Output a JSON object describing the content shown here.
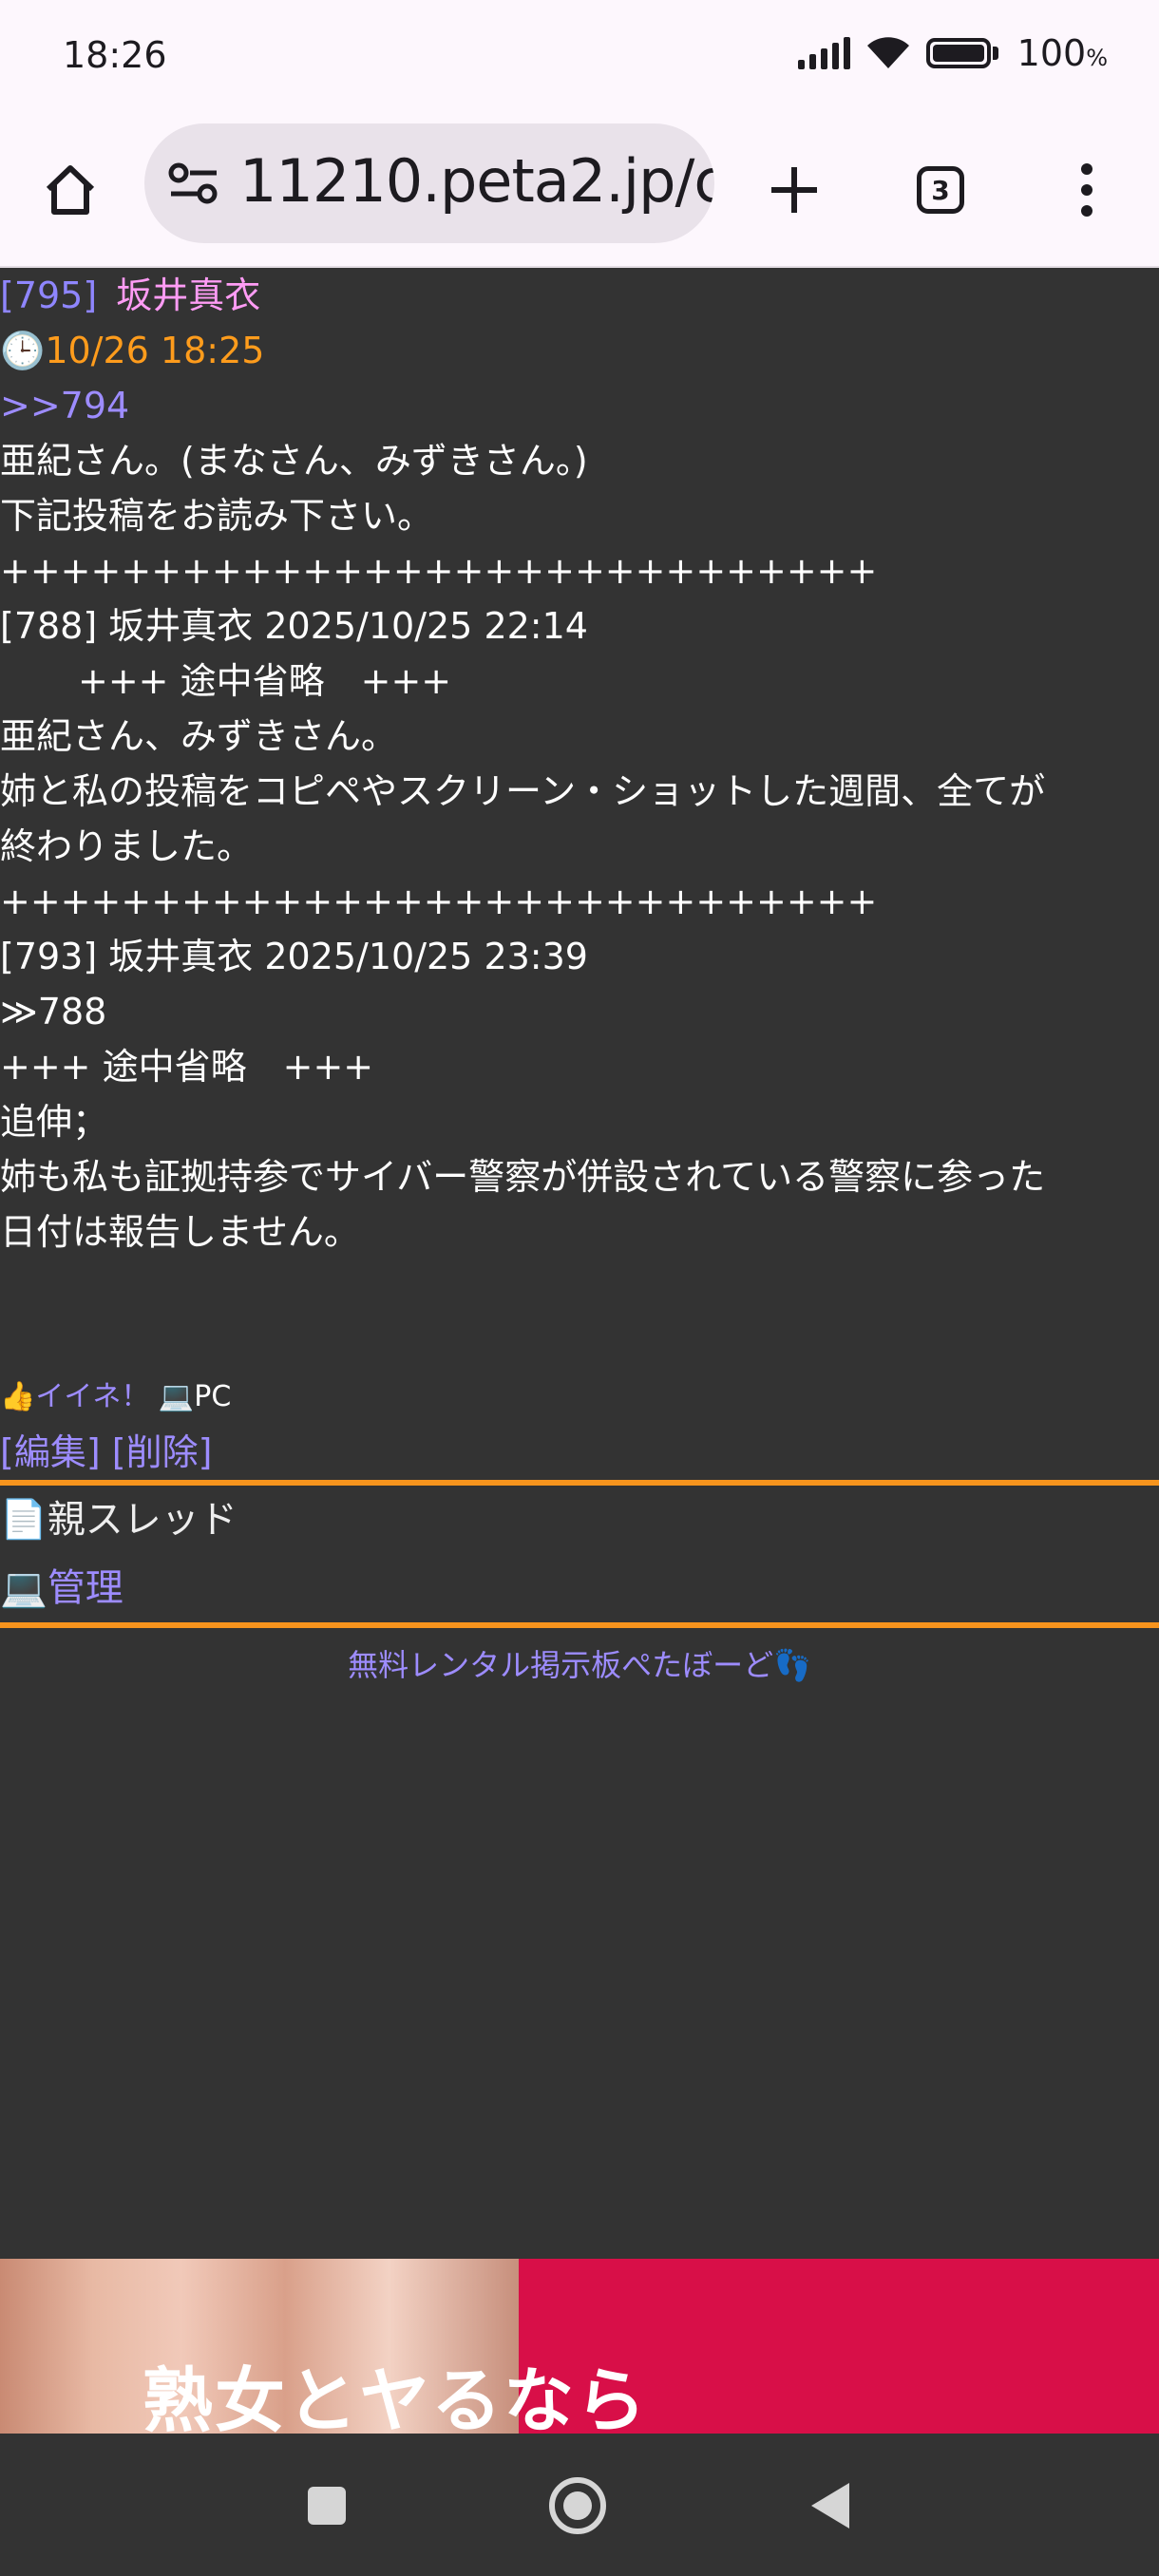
{
  "status": {
    "time": "18:26",
    "battery": "100",
    "battery_unit": "%"
  },
  "browser": {
    "url": "11210.peta2.jp/c",
    "tab_count": "3"
  },
  "post": {
    "number": "[795]",
    "author": "坂井真衣",
    "date": "10/26 18:25",
    "reply_link": ">>794",
    "lines": [
      "亜紀さん。(まなさん、みずきさん。)",
      "下記投稿をお読み下さい。",
      "+++++++++++++++++++++++++++++",
      "[788] 坂井真衣 2025/10/25 22:14",
      "+++ 途中省略　+++",
      "亜紀さん、みずきさん。",
      "姉と私の投稿をコピペやスクリーン・ショットした週間、全てが",
      "終わりました。",
      "+++++++++++++++++++++++++++++",
      "[793] 坂井真衣 2025/10/25 23:39",
      "≫788",
      "+++ 途中省略　+++",
      "追伸；",
      "姉も私も証拠持参でサイバー警察が併設されている警察に参った",
      "日付は報告しません。"
    ],
    "like_label": "イイネ！",
    "device": "PC",
    "edit_label": "[編集]",
    "delete_label": "[削除]"
  },
  "nav": {
    "parent_thread": "親スレッド",
    "admin": "管理"
  },
  "footer": {
    "link": "無料レンタル掲示板ぺたぼーど"
  },
  "ad": {
    "text": "熟女とヤるなら"
  },
  "colors": {
    "background": "#333333",
    "accent": "#f7941d",
    "link": "#9d8cff",
    "author": "#ff9cf5",
    "date": "#ff9c1c"
  }
}
